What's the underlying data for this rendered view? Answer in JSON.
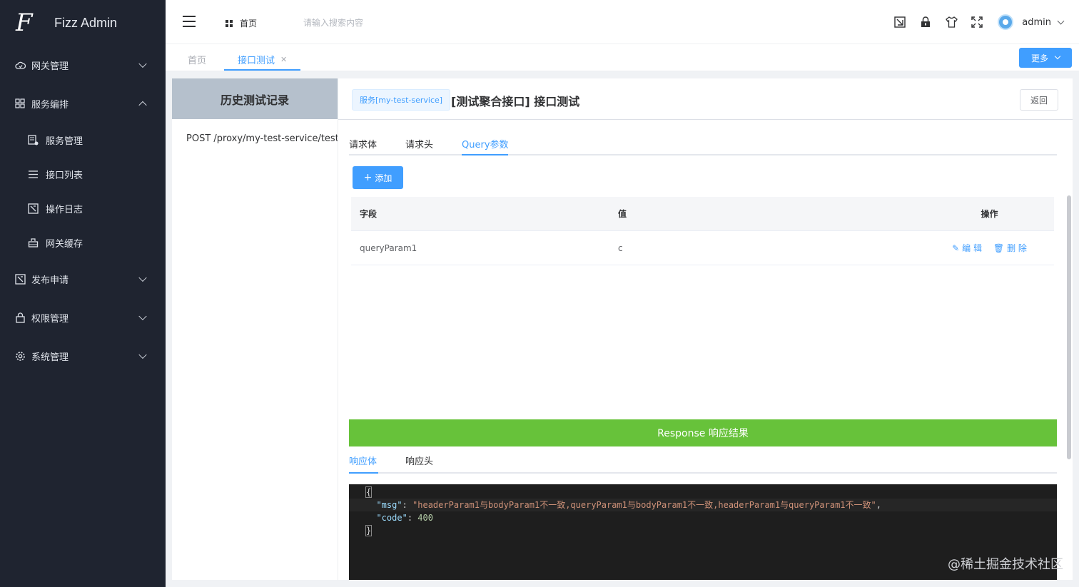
{
  "app": {
    "title": "Fizz Admin",
    "logo_letter": "F"
  },
  "sidebar": {
    "items": [
      {
        "label": "网关管理",
        "icon": "cloud-icon",
        "expanded": false
      },
      {
        "label": "服务编排",
        "icon": "grid-icon",
        "expanded": true,
        "children": [
          {
            "label": "服务管理",
            "icon": "server-icon"
          },
          {
            "label": "接口列表",
            "icon": "list-icon"
          },
          {
            "label": "操作日志",
            "icon": "log-icon"
          },
          {
            "label": "网关缓存",
            "icon": "cache-icon"
          }
        ]
      },
      {
        "label": "发布申请",
        "icon": "publish-icon",
        "expanded": false
      },
      {
        "label": "权限管理",
        "icon": "lock-icon",
        "expanded": false
      },
      {
        "label": "系统管理",
        "icon": "gear-icon",
        "expanded": false
      }
    ]
  },
  "header": {
    "home_label": "首页",
    "search_placeholder": "请输入搜索内容",
    "user_name": "admin",
    "icons": [
      "screenshot-icon",
      "lock-icon",
      "theme-shirt-icon",
      "fullscreen-icon"
    ]
  },
  "tabs": {
    "items": [
      {
        "label": "首页",
        "active": false
      },
      {
        "label": "接口测试",
        "active": true,
        "closable": true
      }
    ],
    "more_label": "更多"
  },
  "history": {
    "title": "历史测试记录",
    "items": [
      "POST /proxy/my-test-service/test-a"
    ]
  },
  "main": {
    "service_tag": "服务[my-test-service]",
    "title": "[测试聚合接口] 接口测试",
    "back_label": "返回",
    "request_tabs": [
      {
        "label": "请求体",
        "active": false
      },
      {
        "label": "请求头",
        "active": false
      },
      {
        "label": "Query参数",
        "active": true
      }
    ],
    "add_label": "添加",
    "table": {
      "headers": [
        "字段",
        "值",
        "操作"
      ],
      "rows": [
        {
          "field": "queryParam1",
          "value": "c",
          "edit": "编 辑",
          "delete": "删 除"
        }
      ]
    },
    "response_title": "Response 响应结果",
    "response_tabs": [
      {
        "label": "响应体",
        "active": true
      },
      {
        "label": "响应头",
        "active": false
      }
    ],
    "response_body": {
      "msg_key": "\"msg\"",
      "msg_value": "\"headerParam1与bodyParam1不一致,queryParam1与bodyParam1不一致,headerParam1与queryParam1不一致\"",
      "code_key": "\"code\"",
      "code_value": "400"
    }
  },
  "watermark": "@稀土掘金技术社区",
  "colors": {
    "accent": "#409eff",
    "sidebar_bg": "#1f2430",
    "success": "#67c23a"
  }
}
